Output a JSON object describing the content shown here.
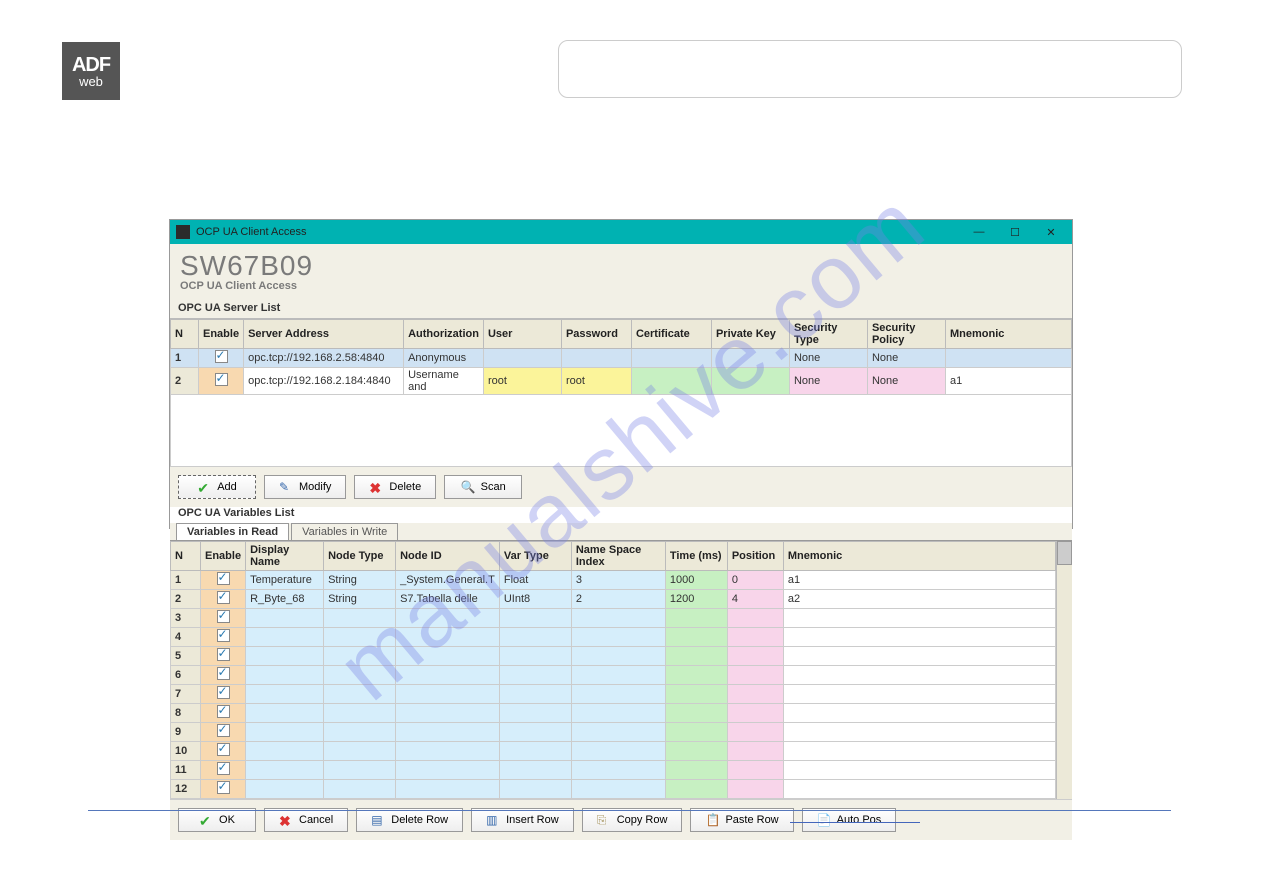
{
  "logo": {
    "top": "ADF",
    "bot": "web"
  },
  "watermark": "manualshive.com",
  "app": {
    "title": "OCP UA Client Access",
    "model": "SW67B09",
    "subtitle": "OCP UA Client Access",
    "server_list_label": "OPC UA Server List",
    "server_headers": {
      "n": "N",
      "enable": "Enable",
      "addr": "Server Address",
      "auth": "Authorization",
      "user": "User",
      "pass": "Password",
      "cert": "Certificate",
      "pkey": "Private Key",
      "sectype": "Security Type",
      "secpol": "Security Policy",
      "mnemonic": "Mnemonic"
    },
    "servers": [
      {
        "n": "1",
        "enable": true,
        "addr": "opc.tcp://192.168.2.58:4840",
        "auth": "Anonymous",
        "user": "",
        "pass": "",
        "cert": "",
        "pkey": "",
        "sectype": "None",
        "secpol": "None",
        "mnemonic": ""
      },
      {
        "n": "2",
        "enable": true,
        "addr": "opc.tcp://192.168.2.184:4840",
        "auth": "Username and",
        "user": "root",
        "pass": "root",
        "cert": "",
        "pkey": "",
        "sectype": "None",
        "secpol": "None",
        "mnemonic": "a1"
      }
    ],
    "toolbar": {
      "add": "Add",
      "modify": "Modify",
      "delete": "Delete",
      "scan": "Scan"
    },
    "variables_label": "OPC UA Variables List",
    "tabs": {
      "read": "Variables in Read",
      "write": "Variables in Write"
    },
    "var_headers": {
      "n": "N",
      "enable": "Enable",
      "dname": "Display Name",
      "ntype": "Node Type",
      "nid": "Node ID",
      "vtype": "Var Type",
      "nsi": "Name Space Index",
      "time": "Time (ms)",
      "pos": "Position",
      "mnemonic": "Mnemonic"
    },
    "variables": [
      {
        "n": "1",
        "enable": true,
        "dname": "Temperature",
        "ntype": "String",
        "nid": "_System.General.T",
        "vtype": "Float",
        "nsi": "3",
        "time": "1000",
        "pos": "0",
        "mnemonic": "a1"
      },
      {
        "n": "2",
        "enable": true,
        "dname": "R_Byte_68",
        "ntype": "String",
        "nid": "S7.Tabella delle",
        "vtype": "UInt8",
        "nsi": "2",
        "time": "1200",
        "pos": "4",
        "mnemonic": "a2"
      },
      {
        "n": "3",
        "enable": true
      },
      {
        "n": "4",
        "enable": true
      },
      {
        "n": "5",
        "enable": true
      },
      {
        "n": "6",
        "enable": true
      },
      {
        "n": "7",
        "enable": true
      },
      {
        "n": "8",
        "enable": true
      },
      {
        "n": "9",
        "enable": true
      },
      {
        "n": "10",
        "enable": true
      },
      {
        "n": "11",
        "enable": true
      },
      {
        "n": "12",
        "enable": true
      }
    ],
    "footer": {
      "ok": "OK",
      "cancel": "Cancel",
      "delrow": "Delete Row",
      "insrow": "Insert Row",
      "copyrow": "Copy Row",
      "pasterow": "Paste Row",
      "autopos": "Auto Pos"
    }
  }
}
